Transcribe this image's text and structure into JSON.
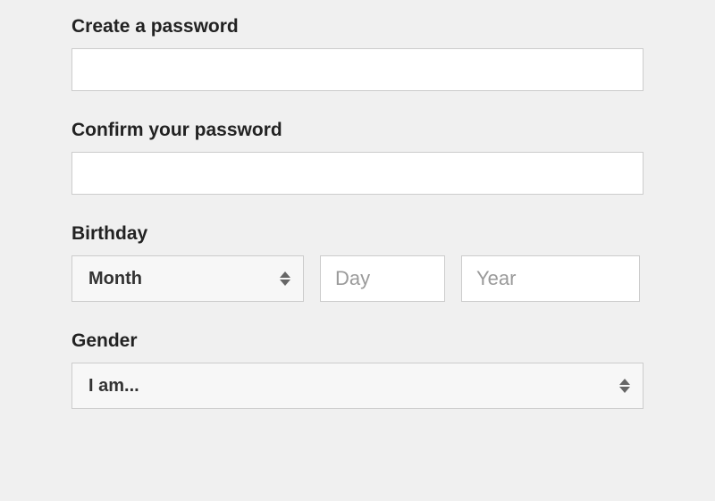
{
  "password": {
    "label": "Create a password",
    "value": ""
  },
  "confirm_password": {
    "label": "Confirm your password",
    "value": ""
  },
  "birthday": {
    "label": "Birthday",
    "month_selected": "Month",
    "day_placeholder": "Day",
    "day_value": "",
    "year_placeholder": "Year",
    "year_value": ""
  },
  "gender": {
    "label": "Gender",
    "selected": "I am..."
  }
}
